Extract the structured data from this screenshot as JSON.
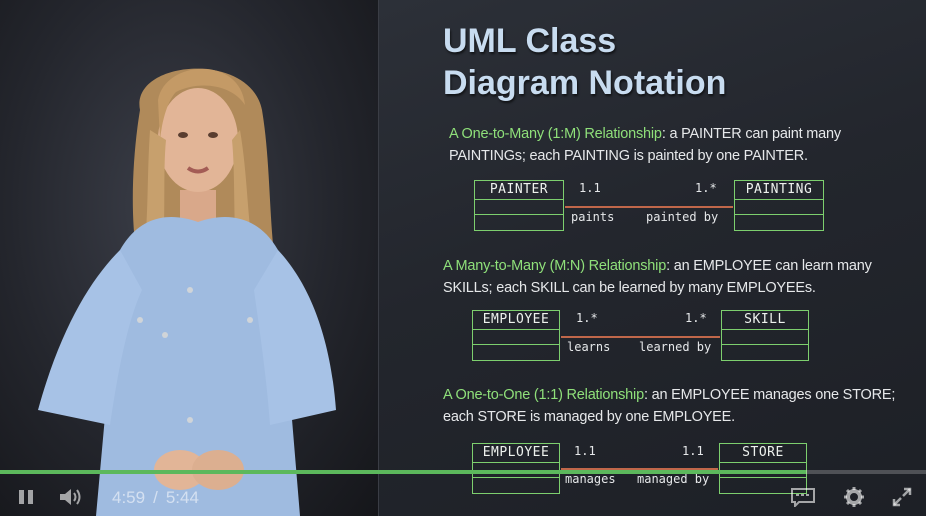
{
  "slide": {
    "title_line1": "UML Class",
    "title_line2": "Diagram Notation",
    "sections": [
      {
        "heading": "A One-to-Many (1:M) Relationship",
        "text1": ": a PAINTER can paint many",
        "text2": "PAINTINGs; each PAINTING is painted by one PAINTER.",
        "left_class": "PAINTER",
        "right_class": "PAINTING",
        "left_mult": "1.1",
        "right_mult": "1.*",
        "left_role": "paints",
        "right_role": "painted by"
      },
      {
        "heading": "A Many-to-Many (M:N) Relationship",
        "text1": ": an EMPLOYEE can learn many",
        "text2": "SKILLs; each SKILL can be learned by many EMPLOYEEs.",
        "left_class": "EMPLOYEE",
        "right_class": "SKILL",
        "left_mult": "1.*",
        "right_mult": "1.*",
        "left_role": "learns",
        "right_role": "learned by"
      },
      {
        "heading": "A One-to-One (1:1) Relationship",
        "text1": ": an EMPLOYEE manages one STORE;",
        "text2": "each STORE is managed by one EMPLOYEE.",
        "left_class": "EMPLOYEE",
        "right_class": "STORE",
        "left_mult": "1.1",
        "right_mult": "1.1",
        "left_role": "manages",
        "right_role": "managed by"
      }
    ]
  },
  "player": {
    "current_time": "4:59",
    "separator": "/",
    "duration": "5:44",
    "progress_fraction": 0.87,
    "accent_color": "#5cb85c",
    "icons": [
      "pause-icon",
      "volume-icon",
      "captions-icon",
      "settings-gear-icon",
      "fullscreen-icon"
    ]
  }
}
